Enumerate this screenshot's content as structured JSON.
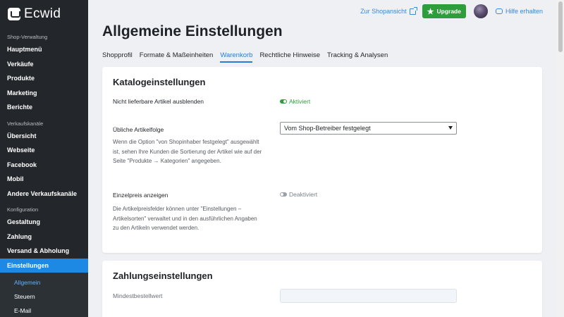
{
  "sidebar": {
    "logo": "Ecwid",
    "sections": [
      {
        "label": "Shop-Verwaltung",
        "items": [
          "Hauptmenü",
          "Verkäufe",
          "Produkte",
          "Marketing",
          "Berichte"
        ]
      },
      {
        "label": "Verkaufskanäle",
        "items": [
          "Übersicht",
          "Webseite",
          "Facebook",
          "Mobil",
          "Andere Verkaufskanäle"
        ]
      },
      {
        "label": "Konfiguration",
        "items": [
          "Gestaltung",
          "Zahlung",
          "Versand & Abholung",
          "Einstellungen"
        ]
      }
    ],
    "active_item": "Einstellungen",
    "sub_items": [
      "Allgemein",
      "Steuern",
      "E-Mail"
    ],
    "active_sub_item": "Allgemein"
  },
  "topbar": {
    "shop_link": "Zur Shopansicht",
    "upgrade_label": "Upgrade",
    "help_label": "Hilfe erhalten"
  },
  "page": {
    "title": "Allgemeine Einstellungen",
    "tabs": [
      "Shopprofil",
      "Formate & Maßeinheiten",
      "Warenkorb",
      "Rechtliche Hinweise",
      "Tracking & Analysen"
    ],
    "active_tab": "Warenkorb"
  },
  "catalog": {
    "title": "Katalogeinstellungen",
    "hide_oos_label": "Nicht lieferbare Artikel ausblenden",
    "hide_oos_status": "Aktiviert",
    "sort_label": "Übliche Artikelfolge",
    "sort_value": "Vom Shop-Betreiber festgelegt",
    "sort_desc": "Wenn die Option \"von Shopinhaber festgelegt\" ausgewählt ist, sehen Ihre Kunden die Sortierung der Artikel wie auf der Seite \"Produkte → Kategorien\" angegeben.",
    "unit_price_label": "Einzelpreis anzeigen",
    "unit_price_status": "Deaktiviert",
    "unit_price_desc": "Die Artikelpreisfelder können unter \"Einstellungen – Artikelsorten\" verwaltet und in den ausführlichen Angaben zu den Artikeln verwendet werden."
  },
  "payment": {
    "title": "Zahlungseinstellungen",
    "min_order_label": "Mindestbestellwert",
    "min_order_value": ""
  },
  "colors": {
    "accent": "#1e88e5",
    "link": "#3c88d6",
    "enabled": "#2e9e3c",
    "sidebar_bg": "#23272b"
  }
}
